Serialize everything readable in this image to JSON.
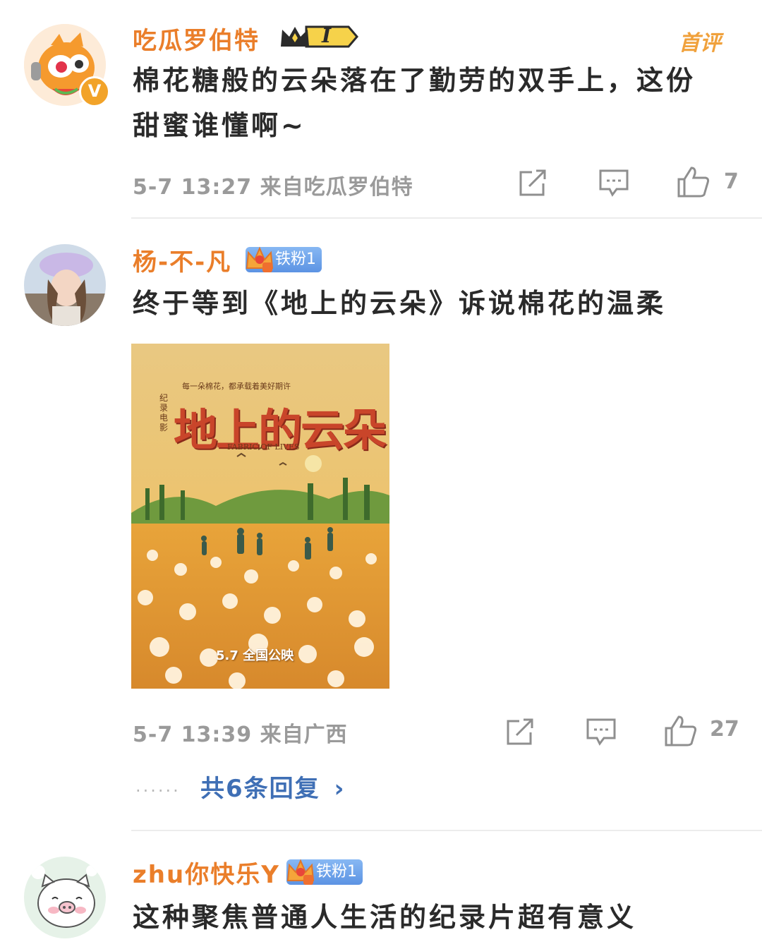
{
  "colors": {
    "username": "#ea7e2a",
    "reply_link": "#3f6fb5",
    "meta": "#9a9a9a",
    "divider": "#ececec",
    "fan_badge": "#6fa3ea"
  },
  "comments": [
    {
      "username": "吃瓜罗伯特",
      "level_badge": "I",
      "top_tag": "首评",
      "text_lines": [
        "棉花糖般的云朵落在了勤劳的双手上，这份",
        "甜蜜谁懂啊~"
      ],
      "meta": "5-7 13:27 来自吃瓜罗伯特",
      "likes": "7",
      "avatar_icon": "cartoon-mascot-avatar",
      "verified_icon": "verified-v-icon"
    },
    {
      "username": "杨-不-凡",
      "fan_badge": "铁粉1",
      "text": "终于等到《地上的云朵》诉说棉花的温柔",
      "poster": {
        "title": "地上的云朵",
        "side_label": "纪录电影",
        "tagline": "每一朵棉花，都承载着美好期许",
        "subtitle": "FABRIC OF LIVES",
        "release": "5.7 全国公映"
      },
      "meta": "5-7 13:39 来自广西",
      "likes": "27",
      "replies_link": "共6条回复",
      "dots": "......",
      "avatar_icon": "girl-photo-avatar"
    },
    {
      "username": "zhu你快乐Y",
      "fan_badge": "铁粉1",
      "text": "这种聚焦普通人生活的纪录片超有意义",
      "avatar_icon": "pig-cartoon-avatar"
    }
  ]
}
